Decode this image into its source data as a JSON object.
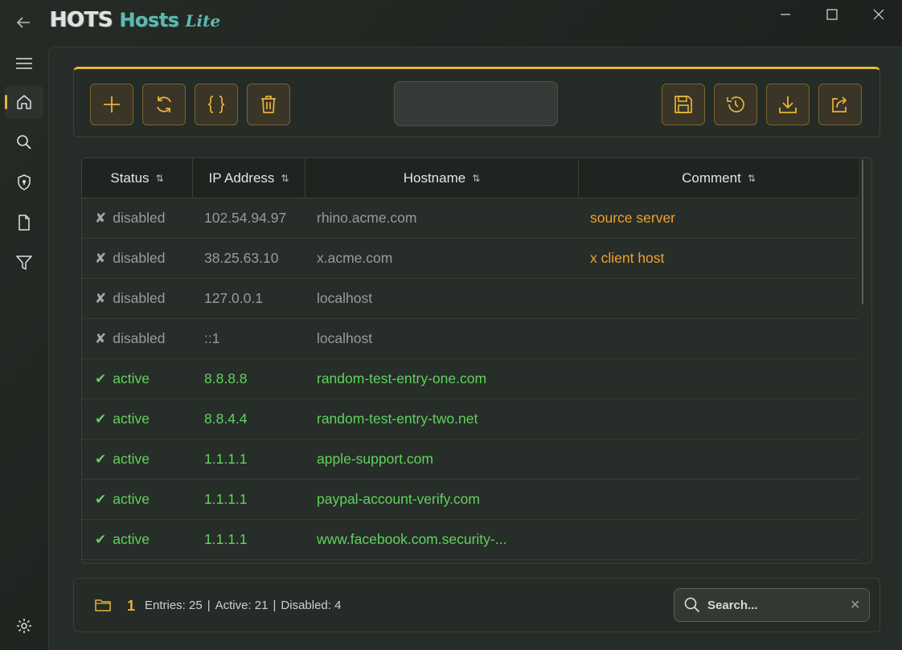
{
  "app": {
    "logo_part1": "HOTS",
    "logo_part2": "Hosts",
    "logo_part3": "Lite"
  },
  "sidebar": {
    "items": [
      {
        "icon": "menu-icon"
      },
      {
        "icon": "home-icon",
        "active": true
      },
      {
        "icon": "search-icon"
      },
      {
        "icon": "shield-icon"
      },
      {
        "icon": "file-icon"
      },
      {
        "icon": "filter-icon"
      },
      {
        "icon": "gear-icon"
      }
    ]
  },
  "toolbar": {
    "left_buttons": [
      "add-icon",
      "refresh-icon",
      "braces-icon",
      "trash-icon"
    ],
    "right_buttons": [
      "save-icon",
      "history-icon",
      "download-icon",
      "share-icon"
    ]
  },
  "table": {
    "columns": [
      "Status",
      "IP Address",
      "Hostname",
      "Comment"
    ],
    "rows": [
      {
        "state": "disabled",
        "mark": "✘",
        "status": "disabled",
        "ip": "102.54.94.97",
        "host": "rhino.acme.com",
        "comment": "source server"
      },
      {
        "state": "disabled",
        "mark": "✘",
        "status": "disabled",
        "ip": "38.25.63.10",
        "host": "x.acme.com",
        "comment": "x client host"
      },
      {
        "state": "disabled",
        "mark": "✘",
        "status": "disabled",
        "ip": "127.0.0.1",
        "host": "localhost",
        "comment": ""
      },
      {
        "state": "disabled",
        "mark": "✘",
        "status": "disabled",
        "ip": "::1",
        "host": "localhost",
        "comment": ""
      },
      {
        "state": "active",
        "mark": "✔",
        "status": "active",
        "ip": "8.8.8.8",
        "host": "random-test-entry-one.com",
        "comment": ""
      },
      {
        "state": "active",
        "mark": "✔",
        "status": "active",
        "ip": "8.8.4.4",
        "host": "random-test-entry-two.net",
        "comment": ""
      },
      {
        "state": "active",
        "mark": "✔",
        "status": "active",
        "ip": "1.1.1.1",
        "host": "apple-support.com",
        "comment": ""
      },
      {
        "state": "active",
        "mark": "✔",
        "status": "active",
        "ip": "1.1.1.1",
        "host": "paypal-account-verify.com",
        "comment": ""
      },
      {
        "state": "active",
        "mark": "✔",
        "status": "active",
        "ip": "1.1.1.1",
        "host": "www.facebook.com.security-...",
        "comment": ""
      }
    ]
  },
  "statusbar": {
    "count": "1",
    "entries": "Entries: 25",
    "active": "Active: 21",
    "disabled": "Disabled: 4",
    "separator": "|",
    "search_placeholder": "Search...",
    "clear": "✕"
  },
  "colors": {
    "accent": "#e8b43a",
    "active": "#5fd35c",
    "comment": "#f0a12e",
    "logo_teal": "#5fb8b0"
  }
}
